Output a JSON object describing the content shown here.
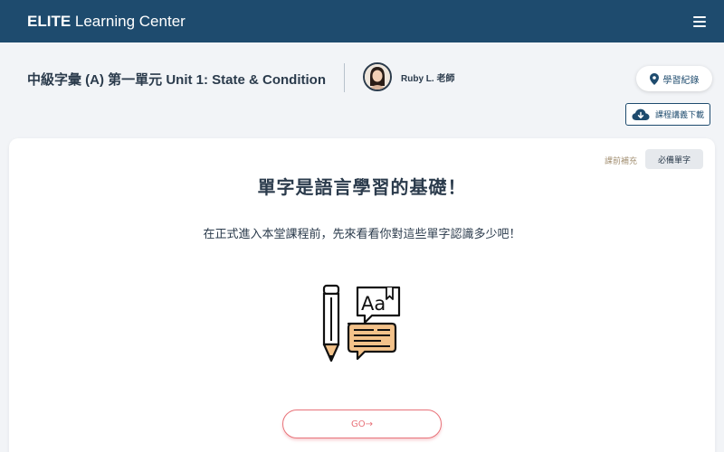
{
  "header": {
    "brand_bold": "ELITE",
    "brand_rest": " Learning Center",
    "menu_icon": "hamburger-icon",
    "bg_color": "#1e4b6e"
  },
  "course": {
    "title": "中級字彙 (A) 第一單元 Unit 1: State & Condition",
    "teacher_name": "Ruby L. 老師"
  },
  "actions": {
    "records_label": "學習紀錄",
    "records_icon": "location-pin-icon",
    "download_label": "課程講義下載",
    "download_icon": "cloud-download-icon"
  },
  "card": {
    "pre_label": "課前補充",
    "vocab_tab": "必備單字",
    "headline": "單字是語言學習的基礎！",
    "subtext": "在正式進入本堂課程前，先來看看你對這些單字認識多少吧！",
    "illustration_icon": "vocabulary-pencil-icon",
    "go_label": "GO→",
    "accent_color": "#e8737a"
  }
}
